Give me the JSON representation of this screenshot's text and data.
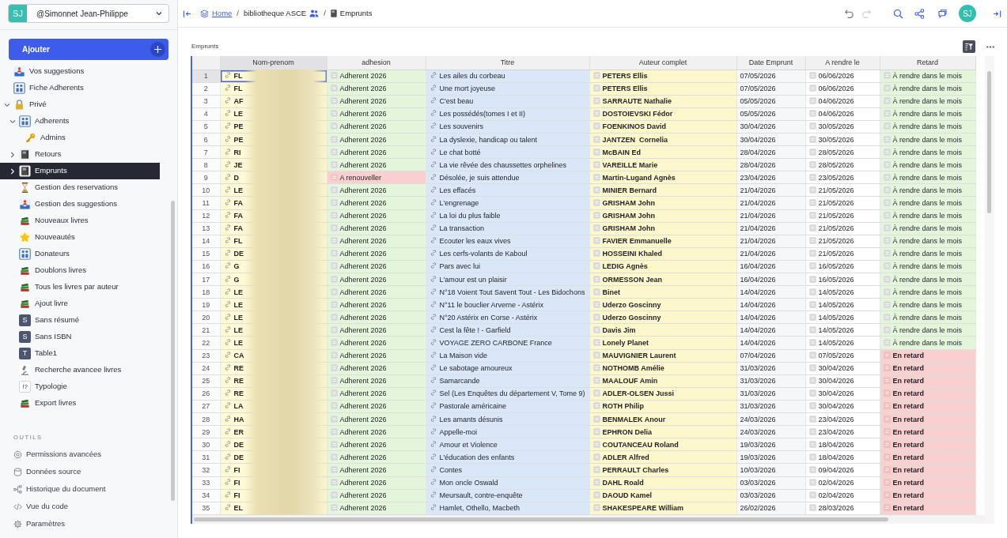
{
  "sidebar": {
    "account": {
      "initials": "SJ",
      "name": "@Simonnet Jean-Philippe"
    },
    "add_button": "Ajouter",
    "pages": [
      {
        "label": "Vos suggestions",
        "kind": "tray",
        "selected": false
      },
      {
        "label": "Fiche Adherents",
        "kind": "figures",
        "selected": false
      },
      {
        "label": "Privé",
        "kind": "lock",
        "selected": false,
        "expanded": true,
        "children": [
          {
            "label": "Adherents",
            "kind": "figures",
            "selected": false,
            "expanded": true,
            "children": [
              {
                "label": "Admins",
                "kind": "key",
                "selected": false
              }
            ]
          },
          {
            "label": "Retours",
            "kind": "book",
            "selected": false,
            "expanded": false
          },
          {
            "label": "Emprunts",
            "kind": "book",
            "selected": true,
            "expanded": false
          },
          {
            "label": "Gestion des reservations",
            "kind": "hourglass",
            "selected": false
          },
          {
            "label": "Gestion des suggestions",
            "kind": "tray",
            "selected": false
          },
          {
            "label": "Nouveaux livres",
            "kind": "books",
            "selected": false
          },
          {
            "label": "Nouveautés",
            "kind": "star",
            "selected": false
          },
          {
            "label": "Donateurs",
            "kind": "figures",
            "selected": false
          },
          {
            "label": "Doublons livres",
            "kind": "books",
            "selected": false
          },
          {
            "label": "Tous les livres par auteur",
            "kind": "books",
            "selected": false
          },
          {
            "label": "Ajout livre",
            "kind": "books",
            "selected": false
          },
          {
            "label": "Sans résumé",
            "kind": "letter",
            "initial": "S",
            "selected": false
          },
          {
            "label": "Sans ISBN",
            "kind": "letter",
            "initial": "S",
            "selected": false
          },
          {
            "label": "Table1",
            "kind": "letter",
            "initial": "T",
            "selected": false
          },
          {
            "label": "Recherche avancee livres",
            "kind": "microscope",
            "selected": false
          },
          {
            "label": "Typologie",
            "kind": "symbol",
            "initial": "!?",
            "selected": false
          },
          {
            "label": "Export livres",
            "kind": "books",
            "selected": false
          }
        ]
      }
    ],
    "tools_heading": "OUTILS",
    "tools": [
      {
        "label": "Permissions avancées",
        "kind": "permissions"
      },
      {
        "label": "Données source",
        "kind": "data"
      },
      {
        "label": "Historique du document",
        "kind": "history"
      },
      {
        "label": "Vue du code",
        "kind": "code"
      },
      {
        "label": "Paramètres",
        "kind": "settings"
      }
    ]
  },
  "topbar": {
    "breadcrumb": [
      {
        "label": "Home",
        "kind": "home"
      },
      {
        "label": "/",
        "kind": "separator"
      },
      {
        "label": "bibliotheque ASCE",
        "kind": "shared"
      },
      {
        "label": "/",
        "kind": "separator"
      },
      {
        "label": "Emprunts",
        "kind": "page"
      }
    ],
    "undo": {
      "disabled": false
    },
    "redo": {
      "disabled": true
    },
    "avatar": "SJ"
  },
  "section": {
    "title": "Emprunts"
  },
  "table": {
    "columns": [
      {
        "label": "Nom-prenom",
        "selected": true
      },
      {
        "label": "adhesion",
        "selected": false
      },
      {
        "label": "Titre",
        "selected": false
      },
      {
        "label": "Auteur complet",
        "selected": false
      },
      {
        "label": "Date Emprunt",
        "selected": false
      },
      {
        "label": "A rendre le",
        "selected": false
      },
      {
        "label": "Retard",
        "selected": false
      }
    ],
    "rows": [
      {
        "number": "1",
        "selected": true,
        "name": "FL",
        "adhesion": {
          "text": "Adherent 2026",
          "kind": "member"
        },
        "title": "Les ailes du corbeau",
        "author": "PETERS Ellis",
        "borrowed": "07/05/2026",
        "due": "06/06/2026",
        "delay": {
          "text": "À rendre dans le mois",
          "kind": "due"
        }
      },
      {
        "number": "2",
        "selected": false,
        "name": "FL",
        "adhesion": {
          "text": "Adherent 2026",
          "kind": "member"
        },
        "title": "Une mort joyeuse",
        "author": "PETERS Ellis",
        "borrowed": "07/05/2026",
        "due": "06/06/2026",
        "delay": {
          "text": "À rendre dans le mois",
          "kind": "due"
        }
      },
      {
        "number": "3",
        "selected": false,
        "name": "AF",
        "adhesion": {
          "text": "Adherent 2026",
          "kind": "member"
        },
        "title": "C'est beau",
        "author": "SARRAUTE Nathalie",
        "borrowed": "05/05/2026",
        "due": "04/06/2026",
        "delay": {
          "text": "À rendre dans le mois",
          "kind": "due"
        }
      },
      {
        "number": "4",
        "selected": false,
        "name": "LE",
        "adhesion": {
          "text": "Adherent 2026",
          "kind": "member"
        },
        "title": "Les possédés(tomes I et II)",
        "author": "DOSTOIEVSKI Fédor",
        "borrowed": "05/05/2026",
        "due": "04/06/2026",
        "delay": {
          "text": "À rendre dans le mois",
          "kind": "due"
        }
      },
      {
        "number": "5",
        "selected": false,
        "name": "PE",
        "adhesion": {
          "text": "Adherent 2026",
          "kind": "member"
        },
        "title": "Les souvenirs",
        "author": "FOENKINOS David",
        "borrowed": "30/04/2026",
        "due": "30/05/2026",
        "delay": {
          "text": "À rendre dans le mois",
          "kind": "due"
        }
      },
      {
        "number": "6",
        "selected": false,
        "name": "PE",
        "adhesion": {
          "text": "Adherent 2026",
          "kind": "member"
        },
        "title": "La dyslexie, handicap ou talent",
        "author": "JANTZEN  Cornelia",
        "borrowed": "30/04/2026",
        "due": "30/05/2026",
        "delay": {
          "text": "À rendre dans le mois",
          "kind": "due"
        }
      },
      {
        "number": "7",
        "selected": false,
        "name": "RI",
        "adhesion": {
          "text": "Adherent 2026",
          "kind": "member"
        },
        "title": "Le chat botté",
        "author": "McBAIN Ed",
        "borrowed": "28/04/2026",
        "due": "28/05/2026",
        "delay": {
          "text": "À rendre dans le mois",
          "kind": "due"
        }
      },
      {
        "number": "8",
        "selected": false,
        "name": "JE",
        "adhesion": {
          "text": "Adherent 2026",
          "kind": "member"
        },
        "title": "La vie rêvée des chaussettes orphelines",
        "author": "VAREILLE Marie",
        "borrowed": "28/04/2026",
        "due": "28/05/2026",
        "delay": {
          "text": "À rendre dans le mois",
          "kind": "due"
        }
      },
      {
        "number": "9",
        "selected": false,
        "name": "D",
        "adhesion": {
          "text": "A renouveller",
          "kind": "renew"
        },
        "title": "Désolée, je suis attendue",
        "author": "Martin-Lugand Agnès",
        "borrowed": "23/04/2026",
        "due": "23/05/2026",
        "delay": {
          "text": "À rendre dans le mois",
          "kind": "due"
        }
      },
      {
        "number": "10",
        "selected": false,
        "name": "LE",
        "adhesion": {
          "text": "Adherent 2026",
          "kind": "member"
        },
        "title": "Les effacés",
        "author": "MINIER Bernard",
        "borrowed": "21/04/2026",
        "due": "21/05/2026",
        "delay": {
          "text": "À rendre dans le mois",
          "kind": "due"
        }
      },
      {
        "number": "11",
        "selected": false,
        "name": "FA",
        "adhesion": {
          "text": "Adherent 2026",
          "kind": "member"
        },
        "title": "L'engrenage",
        "author": "GRISHAM John",
        "borrowed": "21/04/2026",
        "due": "21/05/2026",
        "delay": {
          "text": "À rendre dans le mois",
          "kind": "due"
        }
      },
      {
        "number": "12",
        "selected": false,
        "name": "FA",
        "adhesion": {
          "text": "Adherent 2026",
          "kind": "member"
        },
        "title": "La loi du plus faible",
        "author": "GRISHAM John",
        "borrowed": "21/04/2026",
        "due": "21/05/2026",
        "delay": {
          "text": "À rendre dans le mois",
          "kind": "due"
        }
      },
      {
        "number": "13",
        "selected": false,
        "name": "FA",
        "adhesion": {
          "text": "Adherent 2026",
          "kind": "member"
        },
        "title": "La transaction",
        "author": "GRISHAM John",
        "borrowed": "21/04/2026",
        "due": "21/05/2026",
        "delay": {
          "text": "À rendre dans le mois",
          "kind": "due"
        }
      },
      {
        "number": "14",
        "selected": false,
        "name": "FL",
        "adhesion": {
          "text": "Adherent 2026",
          "kind": "member"
        },
        "title": "Ecouter les eaux vives",
        "author": "FAVIER Emmanuelle",
        "borrowed": "21/04/2026",
        "due": "21/05/2026",
        "delay": {
          "text": "À rendre dans le mois",
          "kind": "due"
        }
      },
      {
        "number": "15",
        "selected": false,
        "name": "DE",
        "adhesion": {
          "text": "Adherent 2026",
          "kind": "member"
        },
        "title": "Les cerfs-volants de Kaboul",
        "author": "HOSSEINI Khaled",
        "borrowed": "21/04/2026",
        "due": "21/05/2026",
        "delay": {
          "text": "À rendre dans le mois",
          "kind": "due"
        }
      },
      {
        "number": "16",
        "selected": false,
        "name": "G",
        "adhesion": {
          "text": "Adherent 2026",
          "kind": "member"
        },
        "title": "Pars avec lui",
        "author": "LEDIG Agnès",
        "borrowed": "16/04/2026",
        "due": "16/05/2026",
        "delay": {
          "text": "À rendre dans le mois",
          "kind": "due"
        }
      },
      {
        "number": "17",
        "selected": false,
        "name": "G",
        "adhesion": {
          "text": "Adherent 2026",
          "kind": "member"
        },
        "title": "L'amour est un plaisir",
        "author": "ORMESSON Jean",
        "borrowed": "16/04/2026",
        "due": "16/05/2026",
        "delay": {
          "text": "À rendre dans le mois",
          "kind": "due"
        }
      },
      {
        "number": "18",
        "selected": false,
        "name": "LE",
        "adhesion": {
          "text": "Adherent 2026",
          "kind": "member"
        },
        "title": "N°18 Voient Tout Savent Tout - Les Bidochons",
        "author": "Binet",
        "borrowed": "14/04/2026",
        "due": "14/05/2026",
        "delay": {
          "text": "À rendre dans le mois",
          "kind": "due"
        }
      },
      {
        "number": "19",
        "selected": false,
        "name": "LE",
        "adhesion": {
          "text": "Adherent 2026",
          "kind": "member"
        },
        "title": "N°11 le bouclier Arverne - Astérix",
        "author": "Uderzo Goscinny",
        "borrowed": "14/04/2026",
        "due": "14/05/2026",
        "delay": {
          "text": "À rendre dans le mois",
          "kind": "due"
        }
      },
      {
        "number": "20",
        "selected": false,
        "name": "LE",
        "adhesion": {
          "text": "Adherent 2026",
          "kind": "member"
        },
        "title": "N°20 Astérix en Corse - Astérix",
        "author": "Uderzo Goscinny",
        "borrowed": "14/04/2026",
        "due": "14/05/2026",
        "delay": {
          "text": "À rendre dans le mois",
          "kind": "due"
        }
      },
      {
        "number": "21",
        "selected": false,
        "name": "LE",
        "adhesion": {
          "text": "Adherent 2026",
          "kind": "member"
        },
        "title": "Cest la fête ! - Garfield",
        "author": "Davis Jim",
        "borrowed": "14/04/2026",
        "due": "14/05/2026",
        "delay": {
          "text": "À rendre dans le mois",
          "kind": "due"
        }
      },
      {
        "number": "22",
        "selected": false,
        "name": "LE",
        "adhesion": {
          "text": "Adherent 2026",
          "kind": "member"
        },
        "title": "VOYAGE ZERO CARBONE France",
        "author": "Lonely Planet",
        "borrowed": "14/04/2026",
        "due": "14/05/2026",
        "delay": {
          "text": "À rendre dans le mois",
          "kind": "due"
        }
      },
      {
        "number": "23",
        "selected": false,
        "name": "CA",
        "adhesion": {
          "text": "Adherent 2026",
          "kind": "member"
        },
        "title": "La Maison vide",
        "author": "MAUVIGNIER Laurent",
        "borrowed": "07/04/2026",
        "due": "07/05/2026",
        "delay": {
          "text": "En retard",
          "kind": "late"
        }
      },
      {
        "number": "24",
        "selected": false,
        "name": "RE",
        "adhesion": {
          "text": "Adherent 2026",
          "kind": "member"
        },
        "title": "Le sabotage amoureux",
        "author": "NOTHOMB Amélie",
        "borrowed": "31/03/2026",
        "due": "30/04/2026",
        "delay": {
          "text": "En retard",
          "kind": "late"
        }
      },
      {
        "number": "25",
        "selected": false,
        "name": "RE",
        "adhesion": {
          "text": "Adherent 2026",
          "kind": "member"
        },
        "title": "Samarcande",
        "author": "MAALOUF Amin",
        "borrowed": "31/03/2026",
        "due": "30/04/2026",
        "delay": {
          "text": "En retard",
          "kind": "late"
        }
      },
      {
        "number": "26",
        "selected": false,
        "name": "RE",
        "adhesion": {
          "text": "Adherent 2026",
          "kind": "member"
        },
        "title": "Sel (Les Enquêtes du département V, Tome 9)",
        "author": "ADLER-OLSEN Jussi",
        "borrowed": "31/03/2026",
        "due": "30/04/2026",
        "delay": {
          "text": "En retard",
          "kind": "late"
        }
      },
      {
        "number": "27",
        "selected": false,
        "name": "LA",
        "adhesion": {
          "text": "Adherent 2026",
          "kind": "member"
        },
        "title": "Pastorale américaine",
        "author": "ROTH Philip",
        "borrowed": "31/03/2026",
        "due": "30/04/2026",
        "delay": {
          "text": "En retard",
          "kind": "late"
        }
      },
      {
        "number": "28",
        "selected": false,
        "name": "HA",
        "adhesion": {
          "text": "Adherent 2026",
          "kind": "member"
        },
        "title": "Les amants désunis",
        "author": "BENMALEK Anour",
        "borrowed": "24/03/2026",
        "due": "23/04/2026",
        "delay": {
          "text": "En retard",
          "kind": "late"
        }
      },
      {
        "number": "29",
        "selected": false,
        "name": "ER",
        "adhesion": {
          "text": "Adherent 2026",
          "kind": "member"
        },
        "title": "Appelle-moi",
        "author": "EPHRON Delia",
        "borrowed": "24/03/2026",
        "due": "23/04/2026",
        "delay": {
          "text": "En retard",
          "kind": "late"
        }
      },
      {
        "number": "30",
        "selected": false,
        "name": "DE",
        "adhesion": {
          "text": "Adherent 2026",
          "kind": "member"
        },
        "title": "Amour et Violence",
        "author": "COUTANCEAU Roland",
        "borrowed": "19/03/2026",
        "due": "18/04/2026",
        "delay": {
          "text": "En retard",
          "kind": "late"
        }
      },
      {
        "number": "31",
        "selected": false,
        "name": "DE",
        "adhesion": {
          "text": "Adherent 2026",
          "kind": "member"
        },
        "title": "L'éducation des enfants",
        "author": "ADLER Alfred",
        "borrowed": "19/03/2026",
        "due": "18/04/2026",
        "delay": {
          "text": "En retard",
          "kind": "late"
        }
      },
      {
        "number": "32",
        "selected": false,
        "name": "FI",
        "adhesion": {
          "text": "Adherent 2026",
          "kind": "member"
        },
        "title": "Contes",
        "author": "PERRAULT Charles",
        "borrowed": "10/03/2026",
        "due": "09/04/2026",
        "delay": {
          "text": "En retard",
          "kind": "late"
        }
      },
      {
        "number": "33",
        "selected": false,
        "name": "FI",
        "adhesion": {
          "text": "Adherent 2026",
          "kind": "member"
        },
        "title": "Mon oncle Oswald",
        "author": "DAHL Roald",
        "borrowed": "03/03/2026",
        "due": "02/04/2026",
        "delay": {
          "text": "En retard",
          "kind": "late"
        }
      },
      {
        "number": "34",
        "selected": false,
        "name": "FI",
        "adhesion": {
          "text": "Adherent 2026",
          "kind": "member"
        },
        "title": "Meursault, contre-enquête",
        "author": "DAOUD Kamel",
        "borrowed": "03/03/2026",
        "due": "02/04/2026",
        "delay": {
          "text": "En retard",
          "kind": "late"
        }
      },
      {
        "number": "35",
        "selected": false,
        "name": "EL",
        "adhesion": {
          "text": "Adherent 2026",
          "kind": "member"
        },
        "title": "Hamlet, Othello, Macbeth",
        "author": "SHAKESPEARE William",
        "borrowed": "26/02/2026",
        "due": "28/03/2026",
        "delay": {
          "text": "En retard",
          "kind": "late"
        }
      }
    ]
  }
}
